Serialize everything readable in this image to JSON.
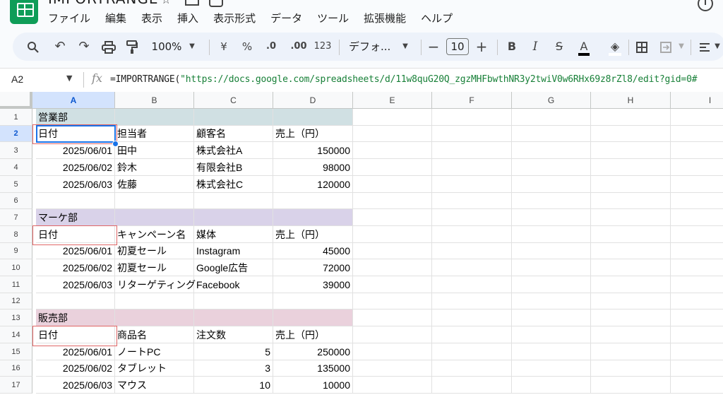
{
  "app": {
    "title": "IMPORTRANGE",
    "menu": [
      "ファイル",
      "編集",
      "表示",
      "挿入",
      "表示形式",
      "データ",
      "ツール",
      "拡張機能",
      "ヘルプ"
    ]
  },
  "toolbar": {
    "zoom": "100%",
    "currency": "¥",
    "percent": "%",
    "decrease_decimal": ".0",
    "increase_decimal": ".00",
    "number_format": "123",
    "font": "デフォ...",
    "font_size": "10",
    "icons": [
      "search-icon",
      "undo-icon",
      "redo-icon",
      "print-icon",
      "paint-format-icon",
      "zoom-caret-icon",
      "font-caret-icon",
      "decrease-font-icon",
      "increase-font-icon",
      "bold-icon",
      "italic-icon",
      "strikethrough-icon",
      "text-color-icon",
      "fill-color-icon",
      "borders-icon",
      "merge-cells-icon",
      "align-icon"
    ]
  },
  "formula_bar": {
    "name_box": "A2",
    "fx": "fx",
    "formula_prefix": "=IMPORTRANGE(",
    "formula_string": "\"https://docs.google.com/spreadsheets/d/11w8quG20Q_zgzMHFbwthNR3y2twiV0w6RHx69z8rZl8/edit?gid=0#"
  },
  "colors": {
    "accent": "#1a73e8",
    "sales_header": "#d0e0e3",
    "marketing_header": "#d9d2e9",
    "sales2_header": "#ead1dc",
    "highlight_box": "#e06666"
  },
  "grid": {
    "columns": [
      "A",
      "B",
      "C",
      "D",
      "E",
      "F",
      "G",
      "H",
      "I"
    ],
    "rows": [
      "1",
      "2",
      "3",
      "4",
      "5",
      "6",
      "7",
      "8",
      "9",
      "10",
      "11",
      "12",
      "13",
      "14",
      "15",
      "16",
      "17"
    ],
    "cells": {
      "r1": {
        "a": "営業部"
      },
      "r2": {
        "a": "日付",
        "b": "担当者",
        "c": "顧客名",
        "d": "売上（円）"
      },
      "r3": {
        "a": "2025/06/01",
        "b": "田中",
        "c": "株式会社A",
        "d": "150000"
      },
      "r4": {
        "a": "2025/06/02",
        "b": "鈴木",
        "c": "有限会社B",
        "d": "98000"
      },
      "r5": {
        "a": "2025/06/03",
        "b": "佐藤",
        "c": "株式会社C",
        "d": "120000"
      },
      "r7": {
        "a": "マーケ部"
      },
      "r8": {
        "a": "日付",
        "b": "キャンペーン名",
        "c": "媒体",
        "d": "売上（円）"
      },
      "r9": {
        "a": "2025/06/01",
        "b": "初夏セール",
        "c": "Instagram",
        "d": "45000"
      },
      "r10": {
        "a": "2025/06/02",
        "b": "初夏セール",
        "c": "Google広告",
        "d": "72000"
      },
      "r11": {
        "a": "2025/06/03",
        "b": "リターゲティング",
        "c": "Facebook",
        "d": "39000"
      },
      "r13": {
        "a": "販売部"
      },
      "r14": {
        "a": "日付",
        "b": "商品名",
        "c": "注文数",
        "d": "売上（円）"
      },
      "r15": {
        "a": "2025/06/01",
        "b": "ノートPC",
        "c": "5",
        "d": "250000"
      },
      "r16": {
        "a": "2025/06/02",
        "b": "タブレット",
        "c": "3",
        "d": "135000"
      },
      "r17": {
        "a": "2025/06/03",
        "b": "マウス",
        "c": "10",
        "d": "10000"
      }
    }
  }
}
